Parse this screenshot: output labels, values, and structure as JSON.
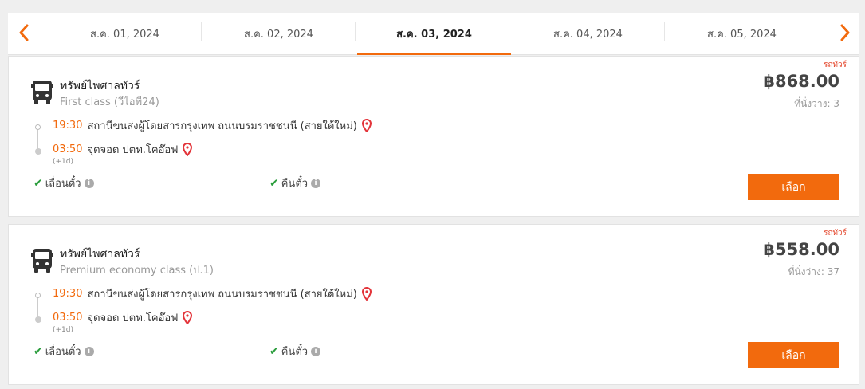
{
  "dates": [
    {
      "label": "ส.ค. 01, 2024",
      "active": false
    },
    {
      "label": "ส.ค. 02, 2024",
      "active": false
    },
    {
      "label": "ส.ค. 03, 2024",
      "active": true
    },
    {
      "label": "ส.ค. 04, 2024",
      "active": false
    },
    {
      "label": "ส.ค. 05, 2024",
      "active": false
    }
  ],
  "colors": {
    "accent": "#f26a0d",
    "pin": "#e3343a",
    "check": "#2a9d3c"
  },
  "icons": {
    "prev": "chevron-left-icon",
    "next": "chevron-right-icon",
    "bus": "bus-icon",
    "pin": "map-pin-icon",
    "check": "check-icon",
    "info": "info-icon"
  },
  "trips": [
    {
      "tag": "รถทัวร์",
      "operator": "ทรัพย์ไพศาลทัวร์",
      "class": "First class (วีไอพี24)",
      "price": "฿868.00",
      "seats": "ที่นั่งว่าง: 3",
      "departure": {
        "time": "19:30",
        "station": "สถานีขนส่งผู้โดยสารกรุงเทพ ถนนบรมราชชนนี (สายใต้ใหม่)"
      },
      "arrival": {
        "time": "03:50",
        "station": "จุดจอด ปตท.โคอ๊อฟ"
      },
      "day_offset": "(+1d)",
      "features": [
        "เลื่อนตั๋ว",
        "คืนตั๋ว"
      ],
      "select_label": "เลือก"
    },
    {
      "tag": "รถทัวร์",
      "operator": "ทรัพย์ไพศาลทัวร์",
      "class": "Premium economy class (ป.1)",
      "price": "฿558.00",
      "seats": "ที่นั่งว่าง: 37",
      "departure": {
        "time": "19:30",
        "station": "สถานีขนส่งผู้โดยสารกรุงเทพ ถนนบรมราชชนนี (สายใต้ใหม่)"
      },
      "arrival": {
        "time": "03:50",
        "station": "จุดจอด ปตท.โคอ๊อฟ"
      },
      "day_offset": "(+1d)",
      "features": [
        "เลื่อนตั๋ว",
        "คืนตั๋ว"
      ],
      "select_label": "เลือก"
    }
  ]
}
